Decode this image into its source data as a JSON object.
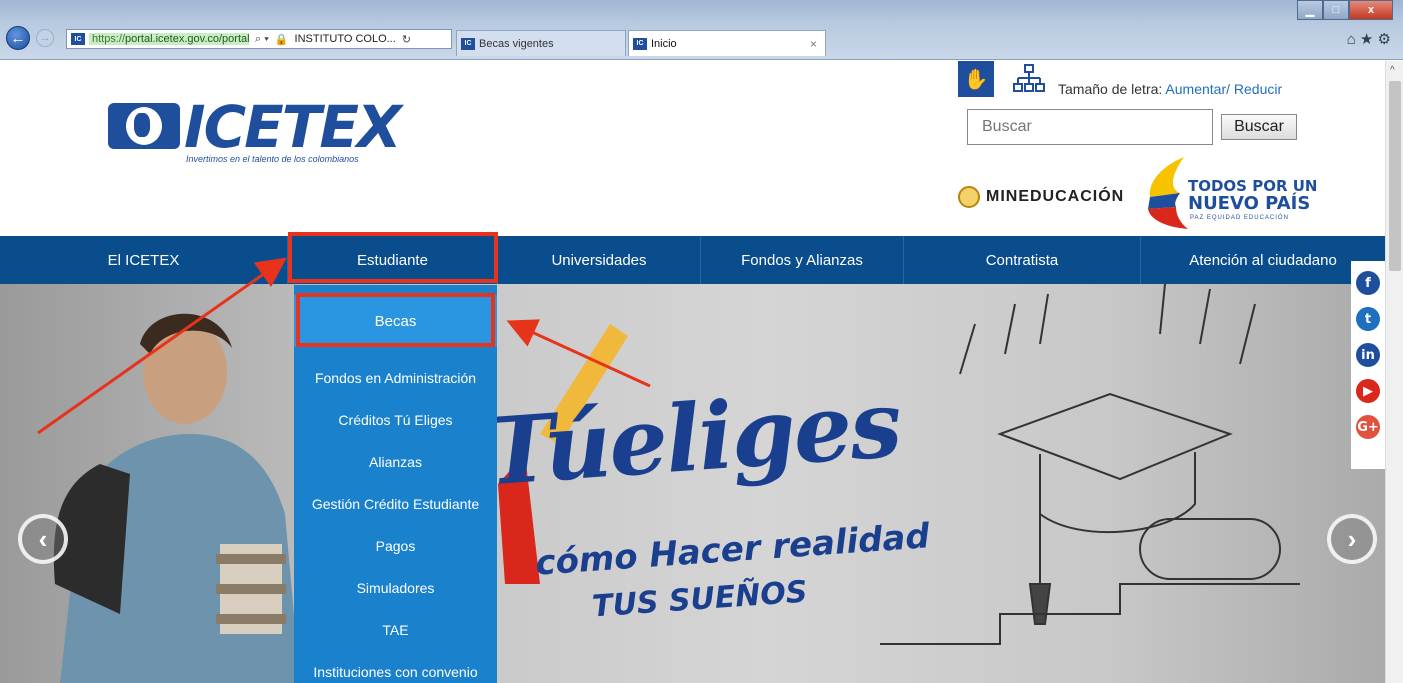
{
  "browser": {
    "url_prefix": "https://",
    "url_domain": "portal.icetex.gov.co/portal",
    "search_glyph": "⌕ ▾",
    "lock_glyph": "🔒",
    "site_identity": "INSTITUTO COLO...",
    "refresh_glyph": "↻",
    "tabs": [
      {
        "label": "Becas vigentes"
      },
      {
        "label": "Inicio",
        "close": "×"
      }
    ],
    "tool_icons": "⌂ ★ ⚙",
    "window": {
      "min": "▁",
      "max": "□",
      "close": "x"
    }
  },
  "header": {
    "logo_text": "ICETEX",
    "logo_tagline": "Invertimos en el talento de los colombianos",
    "font_size_label": "Tamaño de letra:",
    "font_size_increase": "Aumentar/",
    "font_size_decrease": "Reducir",
    "search": {
      "placeholder": "Buscar",
      "button": "Buscar"
    },
    "mineducacion": "MINEDUCACIÓN",
    "gov_logo": {
      "line1": "TODOS POR UN",
      "line2": "NUEVO PAÍS",
      "line3": "PAZ EQUIDAD EDUCACIÓN"
    }
  },
  "nav": {
    "items": [
      {
        "label": "El ICETEX"
      },
      {
        "label": "Estudiante"
      },
      {
        "label": "Universidades"
      },
      {
        "label": "Fondos y Alianzas"
      },
      {
        "label": "Contratista"
      },
      {
        "label": "Atención al ciudadano"
      }
    ]
  },
  "dropdown": {
    "items": [
      {
        "label": "Becas"
      },
      {
        "label": "Fondos en Administración"
      },
      {
        "label": "Créditos Tú Eliges"
      },
      {
        "label": "Alianzas"
      },
      {
        "label": "Gestión Crédito Estudiante"
      },
      {
        "label": "Pagos"
      },
      {
        "label": "Simuladores"
      },
      {
        "label": "TAE"
      },
      {
        "label": "Instituciones con convenio"
      }
    ]
  },
  "hero": {
    "title": "Túeliges",
    "subtitle_1": "cómo Hacer realidad",
    "subtitle_2": "TUS SUEÑOS",
    "prev_glyph": "‹",
    "next_glyph": "›"
  },
  "social": [
    {
      "icon": "facebook-icon",
      "glyph": "f",
      "color": "#1f4e9c"
    },
    {
      "icon": "twitter-icon",
      "glyph": "t",
      "color": "#1f6fbf"
    },
    {
      "icon": "linkedin-icon",
      "glyph": "in",
      "color": "#1f4e9c"
    },
    {
      "icon": "youtube-icon",
      "glyph": "▶",
      "color": "#d9271c"
    },
    {
      "icon": "googleplus-icon",
      "glyph": "G+",
      "color": "#e0513e"
    }
  ],
  "colors": {
    "nav_bg": "#0a4d8c",
    "dropdown_bg": "#1a81cc",
    "highlight": "#e8331c",
    "brand": "#1f4e9c"
  }
}
